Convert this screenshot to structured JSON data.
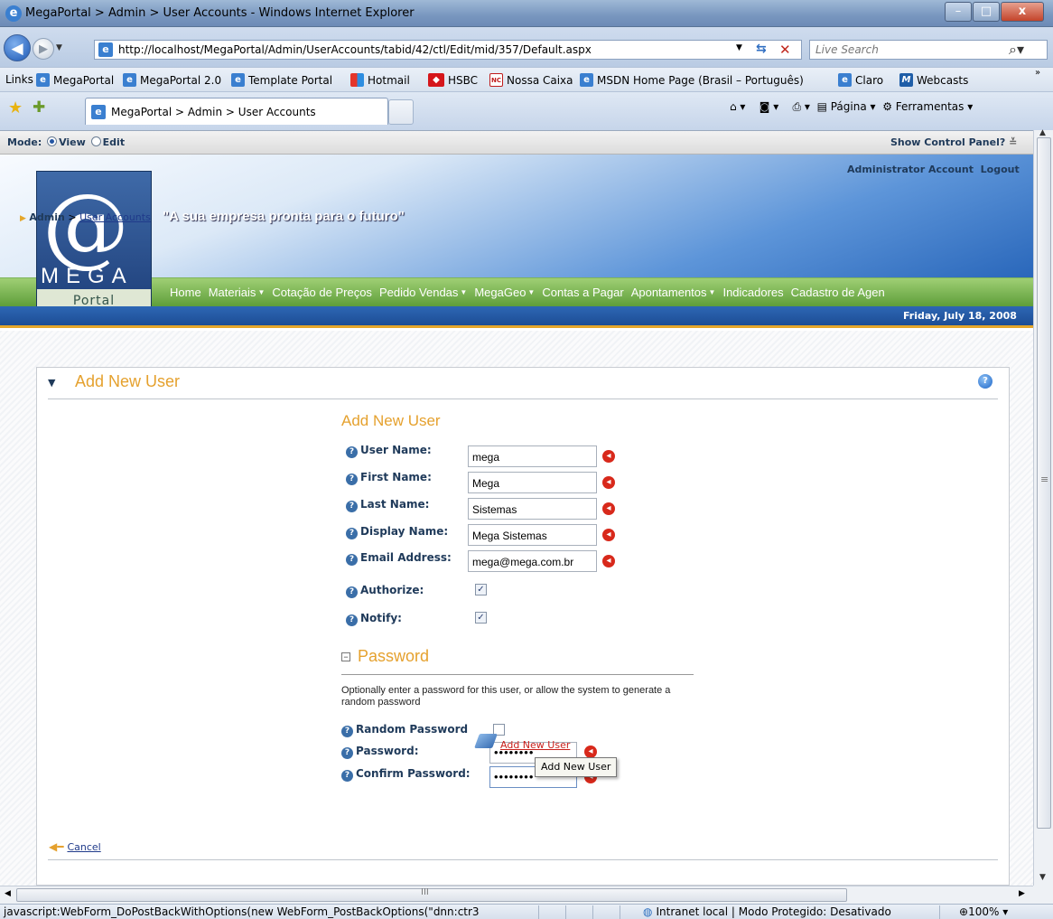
{
  "window": {
    "title": "MegaPortal > Admin > User Accounts - Windows Internet Explorer",
    "minimize": "–",
    "maximize": "□",
    "close": "x"
  },
  "address": {
    "url": "http://localhost/MegaPortal/Admin/UserAccounts/tabid/42/ctl/Edit/mid/357/Default.aspx",
    "search_placeholder": "Live Search"
  },
  "links_bar": {
    "label": "Links",
    "items": [
      "MegaPortal",
      "MegaPortal 2.0",
      "Template Portal",
      "Hotmail",
      "HSBC",
      "Nossa Caixa",
      "MSDN Home Page (Brasil – Português)",
      "Claro",
      "Webcasts"
    ]
  },
  "tab": {
    "title": "MegaPortal > Admin > User Accounts"
  },
  "toolbar": {
    "page_label": "Página",
    "tools_label": "Ferramentas"
  },
  "mode_bar": {
    "label": "Mode:",
    "view": "View",
    "edit": "Edit",
    "selected": "View",
    "control_panel": "Show Control Panel?"
  },
  "header": {
    "account": "Administrator Account",
    "logout": "Logout",
    "slogan": "\"A sua empresa pronta para o futuro\"",
    "logo_at": "@",
    "logo_mega": "MEGA",
    "logo_portal": "Portal",
    "date": "Friday, July 18, 2008"
  },
  "menu": {
    "items": [
      "Home",
      "Materiais",
      "Cotação de Preços",
      "Pedido Vendas",
      "MegaGeo",
      "Contas a Pagar",
      "Apontamentos",
      "Indicadores",
      "Cadastro de Agen"
    ],
    "has_dropdown": [
      false,
      true,
      false,
      true,
      true,
      false,
      true,
      false,
      false
    ]
  },
  "breadcrumb": {
    "root": "Admin",
    "separator": ">",
    "current": "User Accounts"
  },
  "panel": {
    "title": "Add New User"
  },
  "form": {
    "title": "Add New User",
    "fields": [
      {
        "label": "User Name:",
        "value": "mega"
      },
      {
        "label": "First Name:",
        "value": "Mega"
      },
      {
        "label": "Last Name:",
        "value": "Sistemas"
      },
      {
        "label": "Display Name:",
        "value": "Mega Sistemas"
      },
      {
        "label": "Email Address:",
        "value": "mega@mega.com.br"
      }
    ],
    "authorize": {
      "label": "Authorize:",
      "checked": true
    },
    "notify": {
      "label": "Notify:",
      "checked": true
    }
  },
  "password": {
    "section_title": "Password",
    "help_text": "Optionally enter a password for this user, or allow the system to generate a random password",
    "random": {
      "label": "Random Password",
      "checked": false
    },
    "password": {
      "label": "Password:",
      "value": "••••••••"
    },
    "confirm": {
      "label": "Confirm Password:",
      "value": "••••••••"
    }
  },
  "actions": {
    "add_user": "Add New User",
    "tooltip": "Add New User",
    "cancel": "Cancel"
  },
  "status_bar": {
    "text": "javascript:WebForm_DoPostBackWithOptions(new WebForm_PostBackOptions(\"dnn:ctr3",
    "zone": "Intranet local | Modo Protegido: Desativado",
    "zoom": "100%"
  },
  "colors": {
    "accent_orange": "#e5a12e",
    "menu_green": "#5e9e3a",
    "header_blue": "#2563b8",
    "required_red": "#d8291b"
  }
}
